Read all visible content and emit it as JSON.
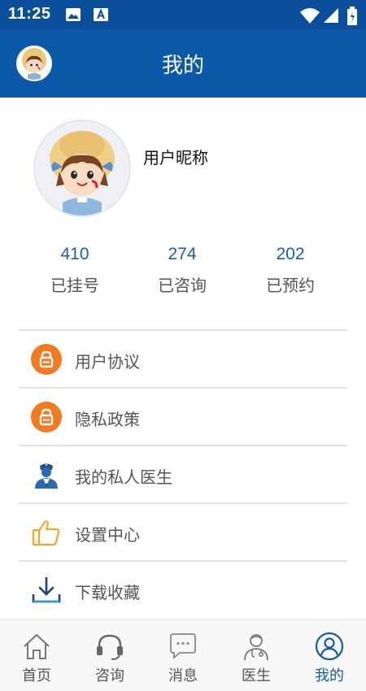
{
  "status_bar": {
    "time": "11:25"
  },
  "header": {
    "title": "我的"
  },
  "profile": {
    "nickname": "用户昵称"
  },
  "stats": [
    {
      "value": "410",
      "label": "已挂号"
    },
    {
      "value": "274",
      "label": "已咨询"
    },
    {
      "value": "202",
      "label": "已预约"
    }
  ],
  "menu": [
    {
      "label": "用户协议",
      "icon": "lock-icon"
    },
    {
      "label": "隐私政策",
      "icon": "lock-icon"
    },
    {
      "label": "我的私人医生",
      "icon": "doctor-icon"
    },
    {
      "label": "设置中心",
      "icon": "thumbs-up-icon"
    },
    {
      "label": "下载收藏",
      "icon": "download-icon"
    }
  ],
  "tabbar": [
    {
      "label": "首页",
      "icon": "home-icon"
    },
    {
      "label": "咨询",
      "icon": "headset-icon"
    },
    {
      "label": "消息",
      "icon": "message-icon"
    },
    {
      "label": "医生",
      "icon": "doctor-icon"
    },
    {
      "label": "我的",
      "icon": "user-icon",
      "active": true
    }
  ],
  "colors": {
    "header": "#0b59a8",
    "accent": "#1c5aa6",
    "orange": "#f47a20"
  }
}
